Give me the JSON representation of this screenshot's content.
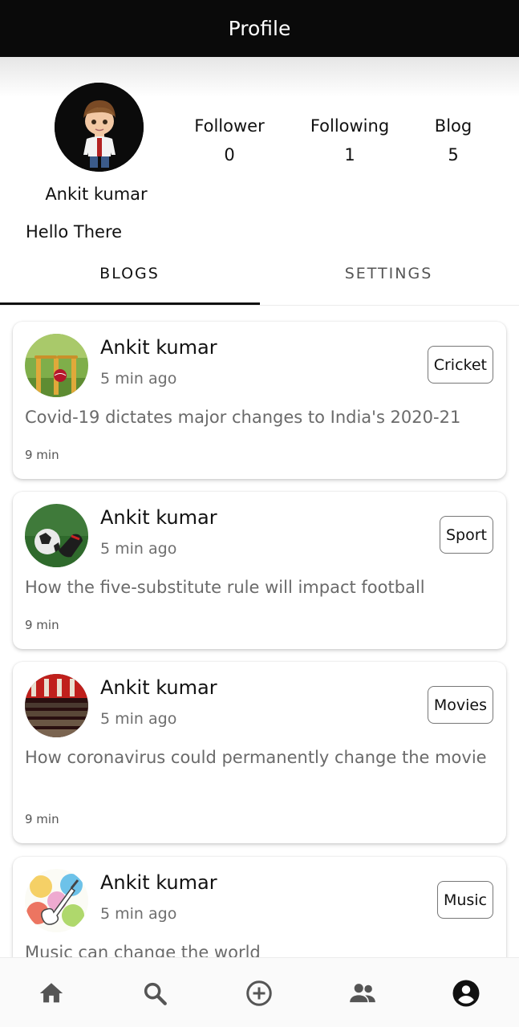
{
  "appbar": {
    "title": "Profile"
  },
  "profile": {
    "name": "Ankit kumar",
    "bio": "Hello There",
    "stats": [
      {
        "label": "Follower",
        "value": "0"
      },
      {
        "label": "Following",
        "value": "1"
      },
      {
        "label": "Blog",
        "value": "5"
      }
    ]
  },
  "tabs": [
    {
      "label": "BLOGS",
      "selected": true
    },
    {
      "label": "SETTINGS",
      "selected": false
    }
  ],
  "posts": [
    {
      "author": "Ankit kumar",
      "time": "5 min ago",
      "tag": "Cricket",
      "title": "Covid-19 dictates major changes to India's 2020-21",
      "read_time": "9 min",
      "thumb": "cricket-stumps-image"
    },
    {
      "author": "Ankit kumar",
      "time": "5 min ago",
      "tag": "Sport",
      "title": "How the five-substitute rule will impact football",
      "read_time": "9 min",
      "thumb": "football-boots-image"
    },
    {
      "author": "Ankit kumar",
      "time": "5 min ago",
      "tag": "Movies",
      "title": "How coronavirus could permanently change the movie",
      "read_time": "9 min",
      "thumb": "cinema-hall-image"
    },
    {
      "author": "Ankit kumar",
      "time": "5 min ago",
      "tag": "Music",
      "title": "Music can change the world",
      "read_time": "",
      "thumb": "guitar-splash-image"
    }
  ],
  "bottom_nav": [
    {
      "icon": "home-icon"
    },
    {
      "icon": "search-icon"
    },
    {
      "icon": "add-circle-icon"
    },
    {
      "icon": "people-icon"
    },
    {
      "icon": "account-circle-icon",
      "active": true
    }
  ]
}
